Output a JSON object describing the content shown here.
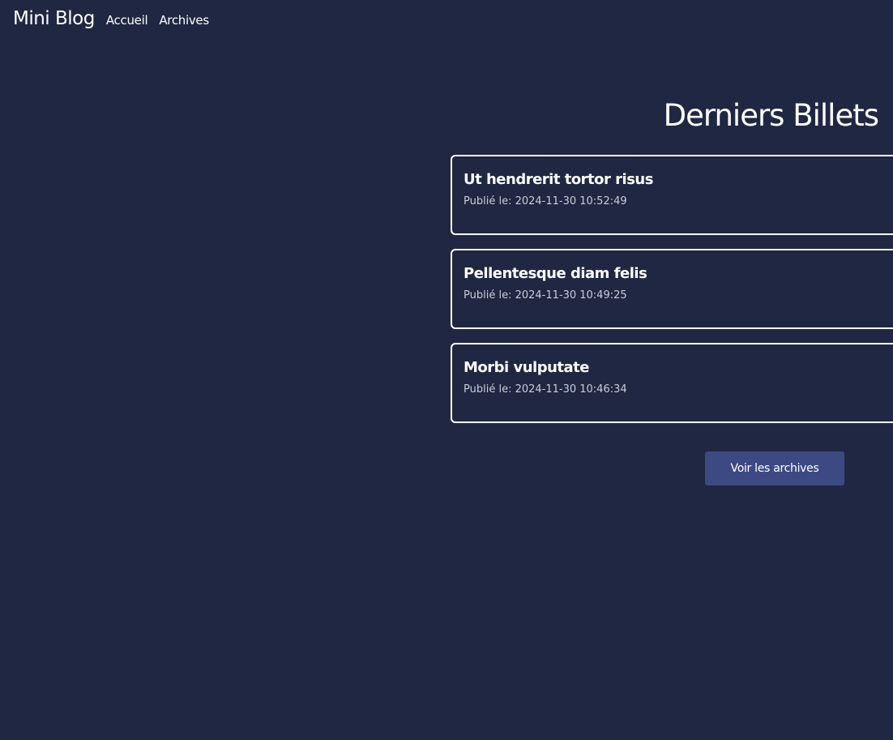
{
  "header": {
    "brand": "Mini Blog",
    "nav": {
      "home_label": "Accueil",
      "archives_label": "Archives"
    }
  },
  "main": {
    "title": "Derniers Billets",
    "posts": [
      {
        "title": "Ut hendrerit tortor risus",
        "date": "Publié le: 2024-11-30 10:52:49"
      },
      {
        "title": "Pellentesque diam felis",
        "date": "Publié le: 2024-11-30 10:49:25"
      },
      {
        "title": "Morbi vulputate",
        "date": "Publié le: 2024-11-30 10:46:34"
      }
    ],
    "archive_button_label": "Voir les archives"
  },
  "colors": {
    "background": "#202743",
    "button": "#3d4983",
    "text": "#ffffff",
    "muted_text": "#c9ccd8"
  }
}
